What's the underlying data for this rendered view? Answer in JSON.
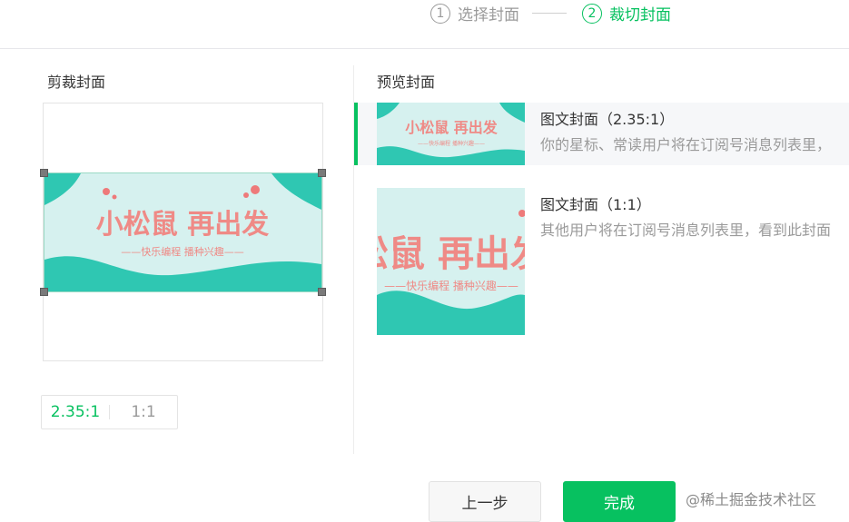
{
  "steps": {
    "items": [
      {
        "num": "1",
        "label": "选择封面",
        "state": "done"
      },
      {
        "num": "2",
        "label": "裁切封面",
        "state": "active"
      }
    ]
  },
  "crop": {
    "title": "剪裁封面",
    "ratios": [
      {
        "label": "2.35:1",
        "selected": true
      },
      {
        "label": "1:1",
        "selected": false
      }
    ]
  },
  "preview": {
    "title": "预览封面",
    "items": [
      {
        "title": "图文封面（2.35:1）",
        "desc": "你的星标、常读用户将在订阅号消息列表里，",
        "selected": true
      },
      {
        "title": "图文封面（1:1）",
        "desc": "其他用户将在订阅号消息列表里，看到此封面",
        "selected": false
      }
    ]
  },
  "cover_image": {
    "headline": "小松鼠 再出发",
    "tagline": "——快乐编程 播种兴趣——",
    "colors": {
      "bg": "#d6f1ef",
      "wave": "#2fc7b2",
      "text": "#ef8a86",
      "bubble": "#ee7a7a"
    }
  },
  "buttons": {
    "prev": "上一步",
    "done": "完成"
  },
  "watermark": "@稀土掘金技术社区",
  "colors": {
    "accent": "#07c160"
  }
}
